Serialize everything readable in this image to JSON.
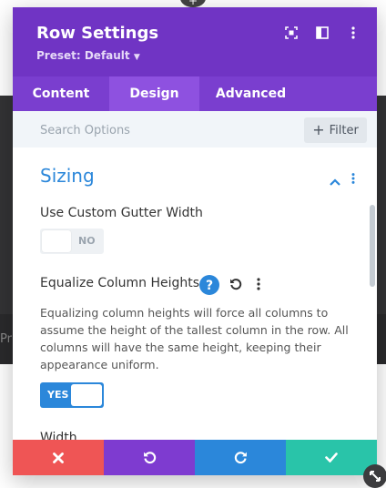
{
  "backdrop": {
    "partial_text": "Pr"
  },
  "modal": {
    "title": "Row Settings",
    "preset": "Preset: Default",
    "header_icons": [
      "focus-mode-icon",
      "columns-layout-icon",
      "more-vertical-icon"
    ]
  },
  "tabs": [
    {
      "label": "Content",
      "active": false
    },
    {
      "label": "Design",
      "active": true
    },
    {
      "label": "Advanced",
      "active": false
    }
  ],
  "search": {
    "placeholder": "Search Options",
    "filter_label": "Filter"
  },
  "section": {
    "title": "Sizing",
    "fields": {
      "gutter": {
        "label": "Use Custom Gutter Width",
        "toggle": "NO"
      },
      "equalize": {
        "label": "Equalize Column Heights",
        "description": "Equalizing column heights will force all columns to assume the height of the tallest column in the row. All columns will have the same height, keeping their appearance uniform.",
        "toggle": "YES"
      },
      "width": {
        "label": "Width"
      }
    }
  },
  "footer": {
    "buttons": [
      "discard-button",
      "undo-button",
      "redo-button",
      "save-button"
    ]
  },
  "colors": {
    "header": "#7034c4",
    "tabs": "#7a3ecf",
    "active_tab": "#8e51e0",
    "accent_blue": "#2b87da",
    "discard": "#ef5555",
    "undo": "#7e3bd0",
    "redo": "#2b87da",
    "save": "#29c4a9"
  }
}
